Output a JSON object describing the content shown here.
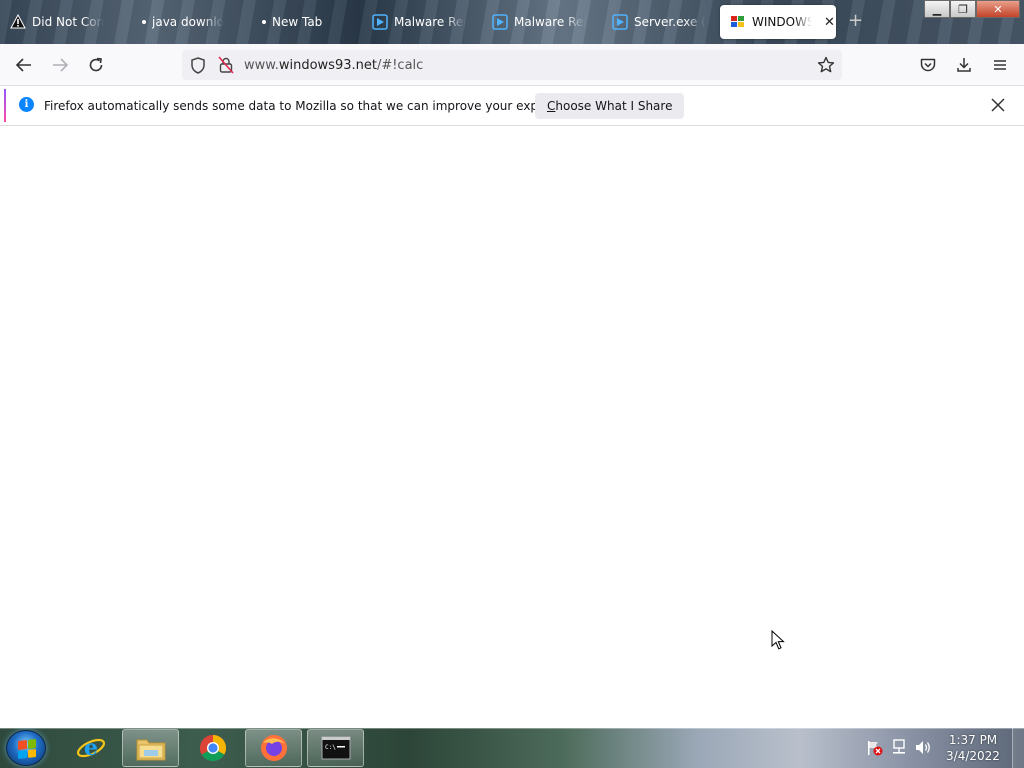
{
  "browser": {
    "tabs": [
      {
        "label": "Did Not Conn",
        "icon": "warning-icon"
      },
      {
        "label": "java downlo",
        "icon": "dot-icon"
      },
      {
        "label": "New Tab",
        "icon": "dot-icon"
      },
      {
        "label": "Malware Rep",
        "icon": "play-icon"
      },
      {
        "label": "Malware Rep",
        "icon": "play-icon"
      },
      {
        "label": "Server.exe (M",
        "icon": "play-icon"
      },
      {
        "label": "WINDOWS",
        "icon": "windows93-icon",
        "active": true
      }
    ],
    "url": {
      "prefix": "www.",
      "host": "windows93.net",
      "path": "/#!calc"
    },
    "infobar": {
      "message": "Firefox automatically sends some data to Mozilla so that we can improve your experience.",
      "button_first": "C",
      "button_rest": "hoose What I Share"
    }
  },
  "taskbar": {
    "apps": [
      "internet-explorer",
      "file-explorer",
      "chrome",
      "firefox",
      "command-prompt"
    ],
    "clock": {
      "time": "1:37 PM",
      "date": "3/4/2022"
    }
  },
  "colors": {
    "accent": "#0a84ff",
    "firefox_orange": "#ff7139"
  }
}
